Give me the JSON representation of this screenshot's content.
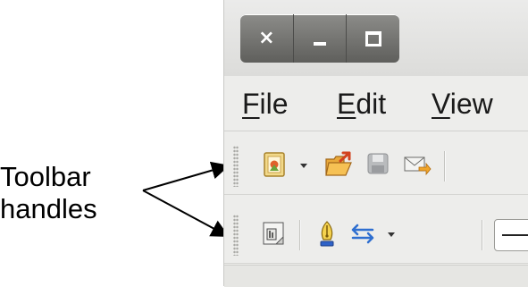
{
  "window": {
    "buttons": [
      {
        "name": "close",
        "glyph": "×"
      },
      {
        "name": "minimize"
      },
      {
        "name": "maximize"
      }
    ]
  },
  "menubar": {
    "items": [
      {
        "mnemonic": "F",
        "rest": "ile"
      },
      {
        "mnemonic": "E",
        "rest": "dit"
      },
      {
        "mnemonic": "V",
        "rest": "iew"
      }
    ]
  },
  "toolbars": [
    {
      "icons": [
        "new-document-icon",
        "dropdown-arrow-icon",
        "open-folder-icon",
        "save-disk-icon",
        "email-document-icon"
      ]
    },
    {
      "icons": [
        "display-rulers-icon",
        "edit-pen-icon",
        "text-direction-arrows-icon",
        "dropdown-arrow-icon",
        "line-style-combo"
      ]
    }
  ],
  "callout": {
    "line1": "Toolbar",
    "line2": "handles"
  }
}
